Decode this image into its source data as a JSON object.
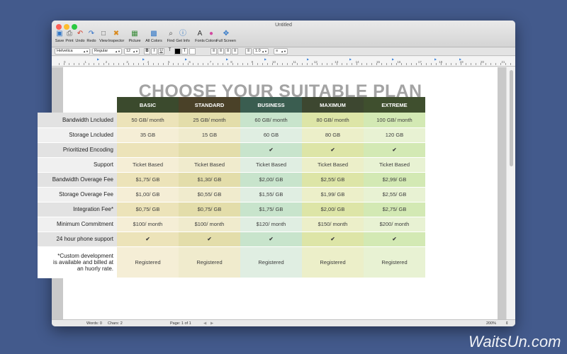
{
  "window": {
    "title": "Untitled"
  },
  "toolbar": [
    {
      "label": "Save",
      "icon": "save-icon",
      "glyph": "▣",
      "color": "#2f76c7"
    },
    {
      "label": "Print",
      "icon": "print-icon",
      "glyph": "⎙",
      "color": "#555555"
    },
    {
      "label": "Undo",
      "icon": "undo-icon",
      "glyph": "↶",
      "color": "#d23a2a"
    },
    {
      "label": "Redo",
      "icon": "redo-icon",
      "glyph": "↷",
      "color": "#2f6fc7"
    },
    {
      "label": "View",
      "icon": "view-icon",
      "glyph": "□",
      "color": "#555555"
    },
    {
      "label": "Inspector",
      "icon": "inspector-icon",
      "glyph": "✖",
      "color": "#d98a1f"
    },
    {
      "label": "Picture",
      "icon": "picture-icon",
      "glyph": "▦",
      "color": "#3a8c3a"
    },
    {
      "label": "All Colors",
      "icon": "colors-grid-icon",
      "glyph": "▩",
      "color": "#2f76c7"
    },
    {
      "label": "Find",
      "icon": "find-icon",
      "glyph": "⌕",
      "color": "#444444"
    },
    {
      "label": "Get Info",
      "icon": "info-icon",
      "glyph": "ⓘ",
      "color": "#2f76c7"
    },
    {
      "label": "Fonts",
      "icon": "fonts-icon",
      "glyph": "A",
      "color": "#333333"
    },
    {
      "label": "Colors",
      "icon": "color-wheel-icon",
      "glyph": "●",
      "color": "#d24aa0"
    },
    {
      "label": "Full Screen",
      "icon": "fullscreen-icon",
      "glyph": "✥",
      "color": "#2f76c7"
    }
  ],
  "format": {
    "font": "Helvetica",
    "style": "Regular",
    "size": "12",
    "spacing": "1.0"
  },
  "ruler": {
    "labels": [
      "0",
      "1",
      "2",
      "3",
      "4",
      "5",
      "6",
      "7",
      "8",
      "9",
      "10",
      "11",
      "12",
      "13",
      "14",
      "15",
      "16",
      "17",
      "18",
      "19",
      "20",
      "21"
    ]
  },
  "document": {
    "headline": "CHOOSE YOUR SUITABLE PLAN"
  },
  "plans": {
    "columns": [
      {
        "name": "BASIC",
        "header": "#3b4a2d",
        "light": "#f5eed6",
        "dark": "#ece3b9"
      },
      {
        "name": "STANDARD",
        "header": "#4a4128",
        "light": "#f0ebcd",
        "dark": "#e3ddaa"
      },
      {
        "name": "BUSINESS",
        "header": "#3a5d50",
        "light": "#e0eee2",
        "dark": "#c8e4cc"
      },
      {
        "name": "MAXIMUM",
        "header": "#3d4730",
        "light": "#ecefc9",
        "dark": "#dde5a7"
      },
      {
        "name": "EXTREME",
        "header": "#3f4f2e",
        "light": "#e8f2d3",
        "dark": "#d3e9b4"
      }
    ],
    "label_colors": {
      "light": "#f0f0f0",
      "dark": "#e2e2e2"
    },
    "rows": [
      {
        "label": "Bandwidth Lncluded",
        "cells": [
          "50 GB/ month",
          "25 GB/ month",
          "60 GB/ month",
          "80 GB/ month",
          "100 GB/ month"
        ]
      },
      {
        "label": "Storage Lncluded",
        "cells": [
          "35 GB",
          "15 GB",
          "60 GB",
          "80 GB",
          "120 GB"
        ]
      },
      {
        "label": "Prioritized Encoding",
        "cells": [
          "",
          "",
          "✔",
          "✔",
          "✔"
        ]
      },
      {
        "label": "Support",
        "cells": [
          "Ticket Based",
          "Ticket Based",
          "Ticket Based",
          "Ticket Based",
          "Ticket Based"
        ]
      },
      {
        "label": "Bandwidth Overage Fee",
        "cells": [
          "$1,75/ GB",
          "$1,30/ GB",
          "$2,00/ GB",
          "$2,55/ GB",
          "$2,99/ GB"
        ]
      },
      {
        "label": "Storage Overage Fee",
        "cells": [
          "$1,00/ GB",
          "$0,55/ GB",
          "$1,55/ GB",
          "$1,99/ GB",
          "$2,55/ GB"
        ]
      },
      {
        "label": "Integration Fee*",
        "cells": [
          "$0,75/ GB",
          "$0,75/ GB",
          "$1,75/ GB",
          "$2,00/ GB",
          "$2,75/ GB"
        ]
      },
      {
        "label": "Minimum Commitment",
        "cells": [
          "$100/ month",
          "$100/ month",
          "$120/ month",
          "$150/ month",
          "$200/ month"
        ]
      },
      {
        "label": "24 hour phone support",
        "cells": [
          "✔",
          "✔",
          "✔",
          "✔",
          "✔"
        ]
      },
      {
        "label": "*Custom development\nis available and billed at\nan huorly rate.",
        "cells": [
          "Registered",
          "Registered",
          "Registered",
          "Registered",
          "Registered"
        ]
      }
    ]
  },
  "status": {
    "words": "Words: 0",
    "chars": "Chars: 2",
    "page": "Page: 1 of 1",
    "zoom": "200%"
  },
  "watermark": "WaitsUn.com"
}
